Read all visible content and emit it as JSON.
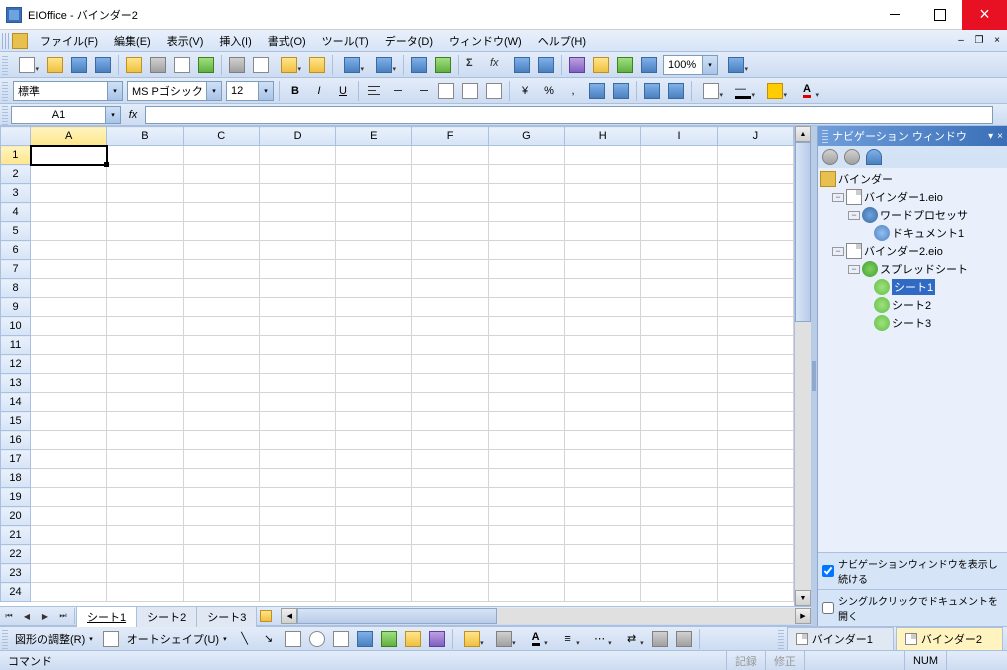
{
  "titlebar": {
    "title": "EIOffice - バインダー2"
  },
  "menubar": {
    "items": [
      "ファイル(F)",
      "編集(E)",
      "表示(V)",
      "挿入(I)",
      "書式(O)",
      "ツール(T)",
      "データ(D)",
      "ウィンドウ(W)",
      "ヘルプ(H)"
    ]
  },
  "toolbar1": {
    "zoom": "100%"
  },
  "toolbar2": {
    "style": "標準",
    "font": "MS Pゴシック",
    "size": "12",
    "bold": "B",
    "italic": "I",
    "underline": "U",
    "yen": "¥",
    "pct": "%",
    "comma": ",",
    "font_label": "A"
  },
  "refbar": {
    "cell": "A1",
    "fx": "fx"
  },
  "grid": {
    "cols": [
      "A",
      "B",
      "C",
      "D",
      "E",
      "F",
      "G",
      "H",
      "I",
      "J"
    ],
    "rows": 24,
    "sel_col": 0,
    "sel_row": 0
  },
  "sheet_tabs": {
    "tabs": [
      "シート1",
      "シート2",
      "シート3"
    ],
    "active": 0
  },
  "navpanel": {
    "title": "ナビゲーション ウィンドウ",
    "root": "バインダー",
    "b1": "バインダー1.eio",
    "b1_wp": "ワードプロセッサ",
    "b1_doc": "ドキュメント1",
    "b2": "バインダー2.eio",
    "b2_ss": "スプレッドシート",
    "b2_s1": "シート1",
    "b2_s2": "シート2",
    "b2_s3": "シート3",
    "chk1": "ナビゲーションウィンドウを表示し続ける",
    "chk2": "シングルクリックでドキュメントを開く"
  },
  "drawbar": {
    "shapes": "図形の調整(R)",
    "autoshape": "オートシェイプ(U)"
  },
  "bindertabs": {
    "b1": "バインダー1",
    "b2": "バインダー2"
  },
  "statusbar": {
    "cmd": "コマンド",
    "rec": "記録",
    "fix": "修正",
    "num": "NUM"
  }
}
